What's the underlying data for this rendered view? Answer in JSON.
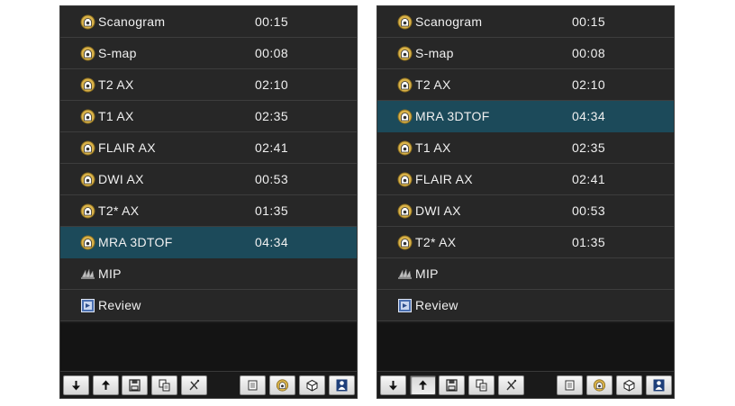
{
  "panels": [
    {
      "rows": [
        {
          "label": "Scanogram",
          "time": "00:15",
          "icon": "scan-coil-icon",
          "selected": false
        },
        {
          "label": "S-map",
          "time": "00:08",
          "icon": "scan-coil-icon",
          "selected": false
        },
        {
          "label": "T2 AX",
          "time": "02:10",
          "icon": "scan-coil-icon",
          "selected": false
        },
        {
          "label": "T1 AX",
          "time": "02:35",
          "icon": "scan-coil-icon",
          "selected": false
        },
        {
          "label": "FLAIR AX",
          "time": "02:41",
          "icon": "scan-coil-icon",
          "selected": false
        },
        {
          "label": "DWI AX",
          "time": "00:53",
          "icon": "scan-coil-icon",
          "selected": false
        },
        {
          "label": "T2* AX",
          "time": "01:35",
          "icon": "scan-coil-icon",
          "selected": false
        },
        {
          "label": "MRA 3DTOF",
          "time": "04:34",
          "icon": "scan-coil-icon",
          "selected": true
        },
        {
          "label": "MIP",
          "time": "",
          "icon": "mip-icon",
          "selected": false
        },
        {
          "label": "Review",
          "time": "",
          "icon": "review-icon",
          "selected": false
        }
      ],
      "pressed_button": ""
    },
    {
      "rows": [
        {
          "label": "Scanogram",
          "time": "00:15",
          "icon": "scan-coil-icon",
          "selected": false
        },
        {
          "label": "S-map",
          "time": "00:08",
          "icon": "scan-coil-icon",
          "selected": false
        },
        {
          "label": "T2 AX",
          "time": "02:10",
          "icon": "scan-coil-icon",
          "selected": false
        },
        {
          "label": "MRA 3DTOF",
          "time": "04:34",
          "icon": "scan-coil-icon",
          "selected": true
        },
        {
          "label": "T1 AX",
          "time": "02:35",
          "icon": "scan-coil-icon",
          "selected": false
        },
        {
          "label": "FLAIR AX",
          "time": "02:41",
          "icon": "scan-coil-icon",
          "selected": false
        },
        {
          "label": "DWI AX",
          "time": "00:53",
          "icon": "scan-coil-icon",
          "selected": false
        },
        {
          "label": "T2* AX",
          "time": "01:35",
          "icon": "scan-coil-icon",
          "selected": false
        },
        {
          "label": "MIP",
          "time": "",
          "icon": "mip-icon",
          "selected": false
        },
        {
          "label": "Review",
          "time": "",
          "icon": "review-icon",
          "selected": false
        }
      ],
      "pressed_button": "move-up-button"
    }
  ],
  "toolbar": [
    {
      "name": "move-down-button",
      "icon": "arrow-down-icon"
    },
    {
      "name": "move-up-button",
      "icon": "arrow-up-icon"
    },
    {
      "name": "save-button",
      "icon": "floppy-icon"
    },
    {
      "name": "copy-button",
      "icon": "copy-icon"
    },
    {
      "name": "delete-button",
      "icon": "cross-icon"
    },
    {
      "name": "list-view-button",
      "icon": "list-icon"
    },
    {
      "name": "scan-button",
      "icon": "scan-coil-icon"
    },
    {
      "name": "3d-view-button",
      "icon": "cube-icon"
    },
    {
      "name": "patient-button",
      "icon": "person-icon"
    }
  ],
  "colors": {
    "row_bg": "#272727",
    "selected_bg": "#1c4a5a",
    "text": "#f0f0f0",
    "coil_icon": "#d9b24a"
  }
}
